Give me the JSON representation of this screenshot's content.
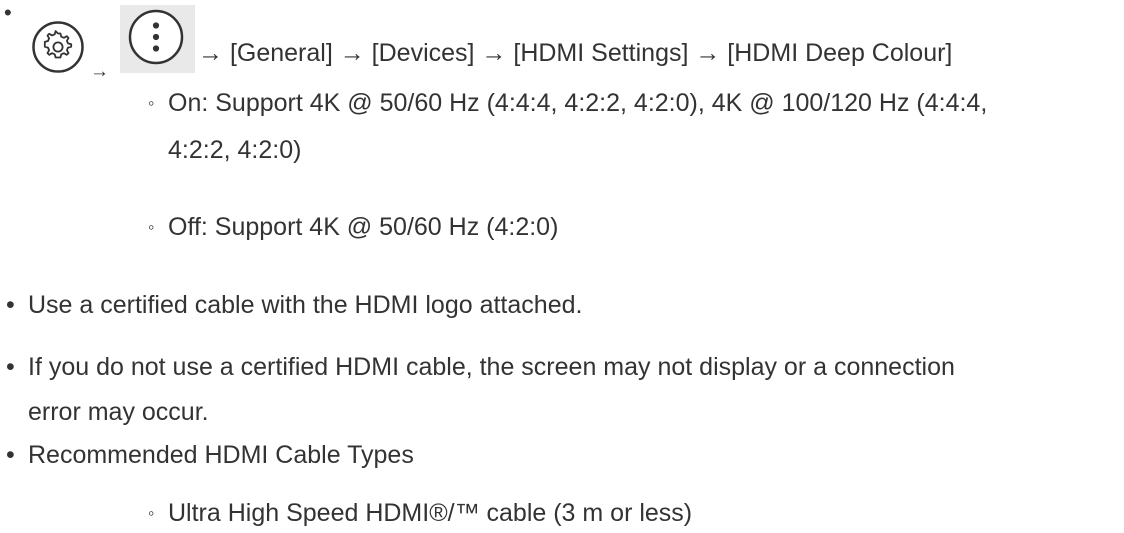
{
  "path": {
    "bullet": "•",
    "arrow": "→",
    "icons": [
      "settings-gear-icon",
      "more-options-icon"
    ],
    "steps_text": "→ [General] → [Devices] → [HDMI Settings] → [HDMI Deep Colour]"
  },
  "options": {
    "sub_bullet": "◦",
    "on_line1": "On: Support 4K @ 50/60 Hz (4:4:4, 4:2:2, 4:2:0), 4K @ 100/120 Hz (4:4:4,",
    "on_line2": "4:2:2, 4:2:0)",
    "off": "Off: Support 4K @ 50/60 Hz (4:2:0)"
  },
  "notes": {
    "certified_cable": "Use a certified cable with the HDMI logo attached.",
    "uncertified_line1": "If you do not use a certified HDMI cable, the screen may not display or a connection",
    "uncertified_line2": "error may occur.",
    "recommended_heading": "Recommended HDMI Cable Types",
    "cable_type": "Ultra High Speed HDMI®/™ cable (3 m or less)"
  },
  "colors": {
    "text": "#333333",
    "icon_highlight_bg": "#e9e9e9"
  }
}
